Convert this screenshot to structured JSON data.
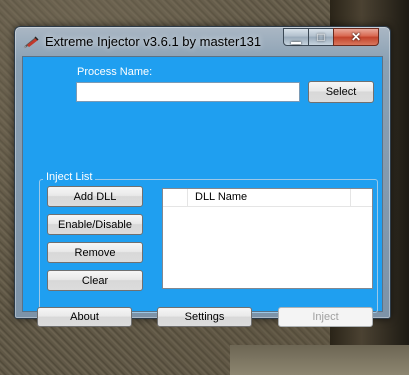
{
  "window": {
    "title": "Extreme Injector v3.6.1 by master131",
    "minimize_glyph": "▁",
    "maximize_glyph": "□",
    "close_glyph": "✕"
  },
  "process": {
    "label": "Process Name:",
    "value": "",
    "placeholder": "",
    "select_label": "Select"
  },
  "inject_list": {
    "label": "Inject List",
    "add_dll_label": "Add DLL",
    "enable_disable_label": "Enable/Disable",
    "remove_label": "Remove",
    "clear_label": "Clear",
    "columns": [
      "",
      "DLL Name",
      ""
    ],
    "rows": []
  },
  "footer": {
    "about_label": "About",
    "settings_label": "Settings",
    "inject_label": "Inject"
  },
  "colors": {
    "client_bg": "#1f9ff0",
    "title_text": "#000000"
  }
}
